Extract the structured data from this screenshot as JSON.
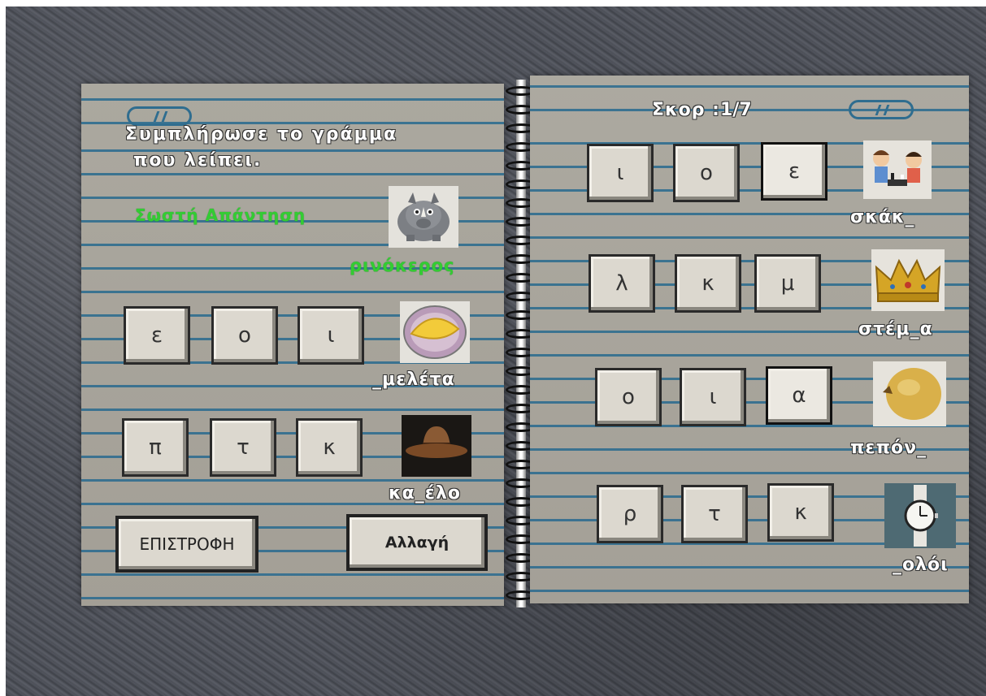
{
  "instructions": {
    "line1": "Συμπλήρωσε το γράμμα",
    "line2": "που λείπει."
  },
  "score": {
    "label": "Σκορ :",
    "value": "1/7"
  },
  "feedback": "Σωστή Απάντηση",
  "solved": {
    "word": "ρινόκερος",
    "icon": "rhino-icon"
  },
  "left_questions": [
    {
      "options": [
        "ε",
        "ο",
        "ι"
      ],
      "word": "_μελέτα",
      "icon": "omelette-icon"
    },
    {
      "options": [
        "π",
        "τ",
        "κ"
      ],
      "word": "κα_έλο",
      "icon": "hat-icon"
    }
  ],
  "right_questions": [
    {
      "options": [
        "ι",
        "ο",
        "ε"
      ],
      "word": "σκάκ_",
      "icon": "chess-kids-icon"
    },
    {
      "options": [
        "λ",
        "κ",
        "μ"
      ],
      "word": "στέμ_α",
      "icon": "crown-icon"
    },
    {
      "options": [
        "ο",
        "ι",
        "α"
      ],
      "word": "πεπόν_",
      "icon": "melon-icon"
    },
    {
      "options": [
        "ρ",
        "τ",
        "κ"
      ],
      "word": "_ολόι",
      "icon": "watch-icon"
    }
  ],
  "buttons": {
    "back": "ΕΠΙΣΤΡΟΦΗ",
    "change": "Αλλαγή"
  },
  "colors": {
    "correct": "#33cc33",
    "rule": "#2f6d8f",
    "page": "#a8a59c"
  }
}
